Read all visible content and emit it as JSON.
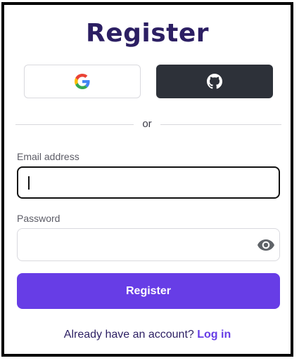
{
  "title": "Register",
  "social": {
    "google_icon": "google-g-logo",
    "github_icon": "github-octocat-icon"
  },
  "divider": {
    "text": "or"
  },
  "email": {
    "label": "Email address",
    "value": ""
  },
  "password": {
    "label": "Password",
    "value": "",
    "toggle_icon": "eye-icon"
  },
  "submit": {
    "label": "Register"
  },
  "footer": {
    "prompt": "Already have an account?",
    "link": "Log in"
  },
  "colors": {
    "title": "#2c1f63",
    "accent": "#673de6",
    "github_bg": "#2d3139"
  }
}
